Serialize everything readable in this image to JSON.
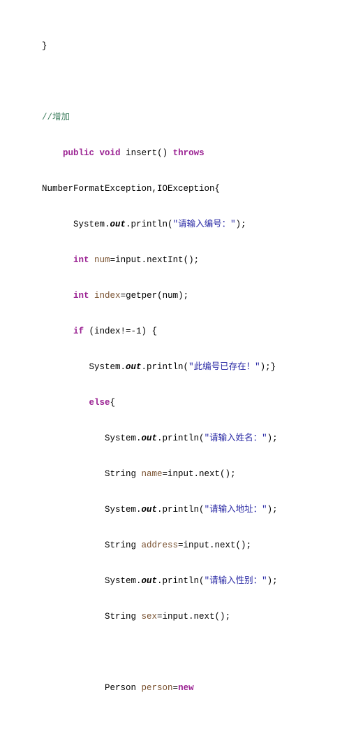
{
  "code": {
    "l1": "}",
    "l2_comment": "//增加",
    "l3_p1": "public",
    "l3_p2": "void",
    "l3_p3": " insert() ",
    "l3_p4": "throws",
    "l4_exceptions": "NumberFormatException,IOException{",
    "l5_p1": "System.",
    "l5_out": "out",
    "l5_p2": ".println(",
    "l5_str": "\"请输入编号：\"",
    "l5_p3": ");",
    "l6_int": "int",
    "l6_sp": " ",
    "l6_var": "num",
    "l6_rest": "=input.nextInt();",
    "l7_int": "int",
    "l7_sp": " ",
    "l7_var": "index",
    "l7_rest": "=getper(num);",
    "l8_if": "if",
    "l8_rest": " (index!=-1) {",
    "l9_p1": "System.",
    "l9_out": "out",
    "l9_p2": ".println(",
    "l9_str": "\"此编号已存在！\"",
    "l9_p3": ");}",
    "l10_else": "else",
    "l10_brace": "{",
    "l11_p1": "System.",
    "l11_out": "out",
    "l11_p2": ".println(",
    "l11_str": "\"请输入姓名：\"",
    "l11_p3": ");",
    "l12_type": "String ",
    "l12_var": "name",
    "l12_rest": "=input.next();",
    "l13_p1": "System.",
    "l13_out": "out",
    "l13_p2": ".println(",
    "l13_str": "\"请输入地址：\"",
    "l13_p3": ");",
    "l14_type": "String ",
    "l14_var": "address",
    "l14_rest": "=input.next();",
    "l15_p1": "System.",
    "l15_out": "out",
    "l15_p2": ".println(",
    "l15_str": "\"请输入性别：\"",
    "l15_p3": ");",
    "l16_type": "String ",
    "l16_var": "sex",
    "l16_rest": "=input.next();",
    "l17_type": "Person ",
    "l17_var": "person",
    "l17_eq": "=",
    "l17_new": "new"
  }
}
